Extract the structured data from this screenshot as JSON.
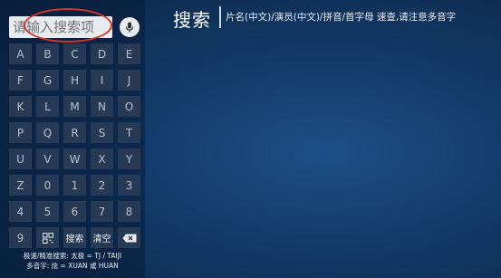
{
  "search": {
    "placeholder": "请输入搜索项"
  },
  "header": {
    "title": "搜索",
    "subtitle": "片名(中文)/演员(中文)/拼音/首字母 速查,请注意多音字"
  },
  "keyboard": {
    "rows": [
      [
        "A",
        "B",
        "C",
        "D",
        "E"
      ],
      [
        "F",
        "G",
        "H",
        "I",
        "J"
      ],
      [
        "K",
        "L",
        "M",
        "N",
        "O"
      ],
      [
        "P",
        "Q",
        "R",
        "S",
        "T"
      ],
      [
        "U",
        "V",
        "W",
        "X",
        "Y"
      ],
      [
        "Z",
        "0",
        "1",
        "2",
        "3"
      ],
      [
        "4",
        "5",
        "6",
        "7",
        "8"
      ]
    ],
    "bottom": {
      "nine": "9",
      "qr_icon": "qr-code-icon",
      "search_label": "搜索",
      "clear_label": "清空",
      "delete_icon": "backspace-icon"
    }
  },
  "hints": {
    "line1": "极速/精准搜索: 太极 = TJ / TAIJI",
    "line2": "多音字: 炫 = XUAN 或 HUAN"
  },
  "colors": {
    "accent_red": "#d6332a",
    "key_bg": "#263a55",
    "background": "#123a68"
  }
}
